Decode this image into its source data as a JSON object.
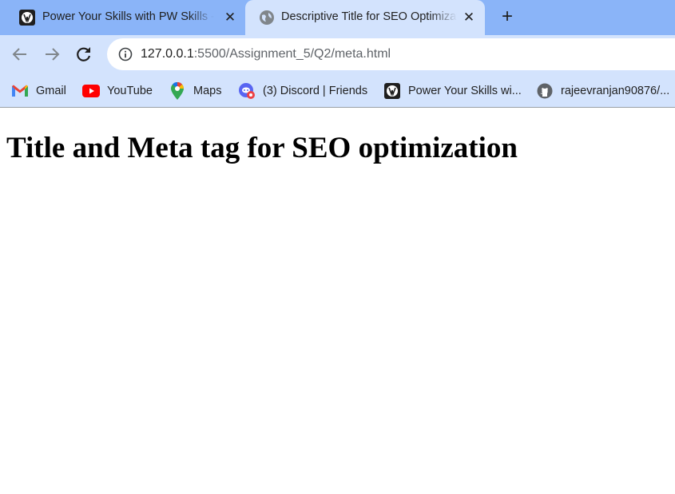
{
  "browser": {
    "tabs": [
      {
        "title": "Power Your Skills with PW Skills - PW Skills",
        "favicon": "pw-skills-logo",
        "active": false
      },
      {
        "title": "Descriptive Title for SEO Optimization",
        "favicon": "globe-icon",
        "active": true
      }
    ],
    "new_tab": "+",
    "close_symbol": "✕",
    "url_host": "127.0.0.1",
    "url_path": ":5500/Assignment_5/Q2/meta.html",
    "bookmarks": [
      {
        "label": "Gmail",
        "icon": "gmail-icon"
      },
      {
        "label": "YouTube",
        "icon": "youtube-icon"
      },
      {
        "label": "Maps",
        "icon": "maps-pin-icon"
      },
      {
        "label": "(3) Discord | Friends",
        "icon": "discord-icon"
      },
      {
        "label": "Power Your Skills wi...",
        "icon": "pw-skills-logo"
      },
      {
        "label": "rajeevranjan90876/...",
        "icon": "github-icon"
      }
    ]
  },
  "page": {
    "heading": "Title and Meta tag for SEO optimization"
  },
  "colors": {
    "tabstrip": "#8ab4f8",
    "toolbar": "#d3e3fd",
    "text": "#1f1f1f"
  }
}
